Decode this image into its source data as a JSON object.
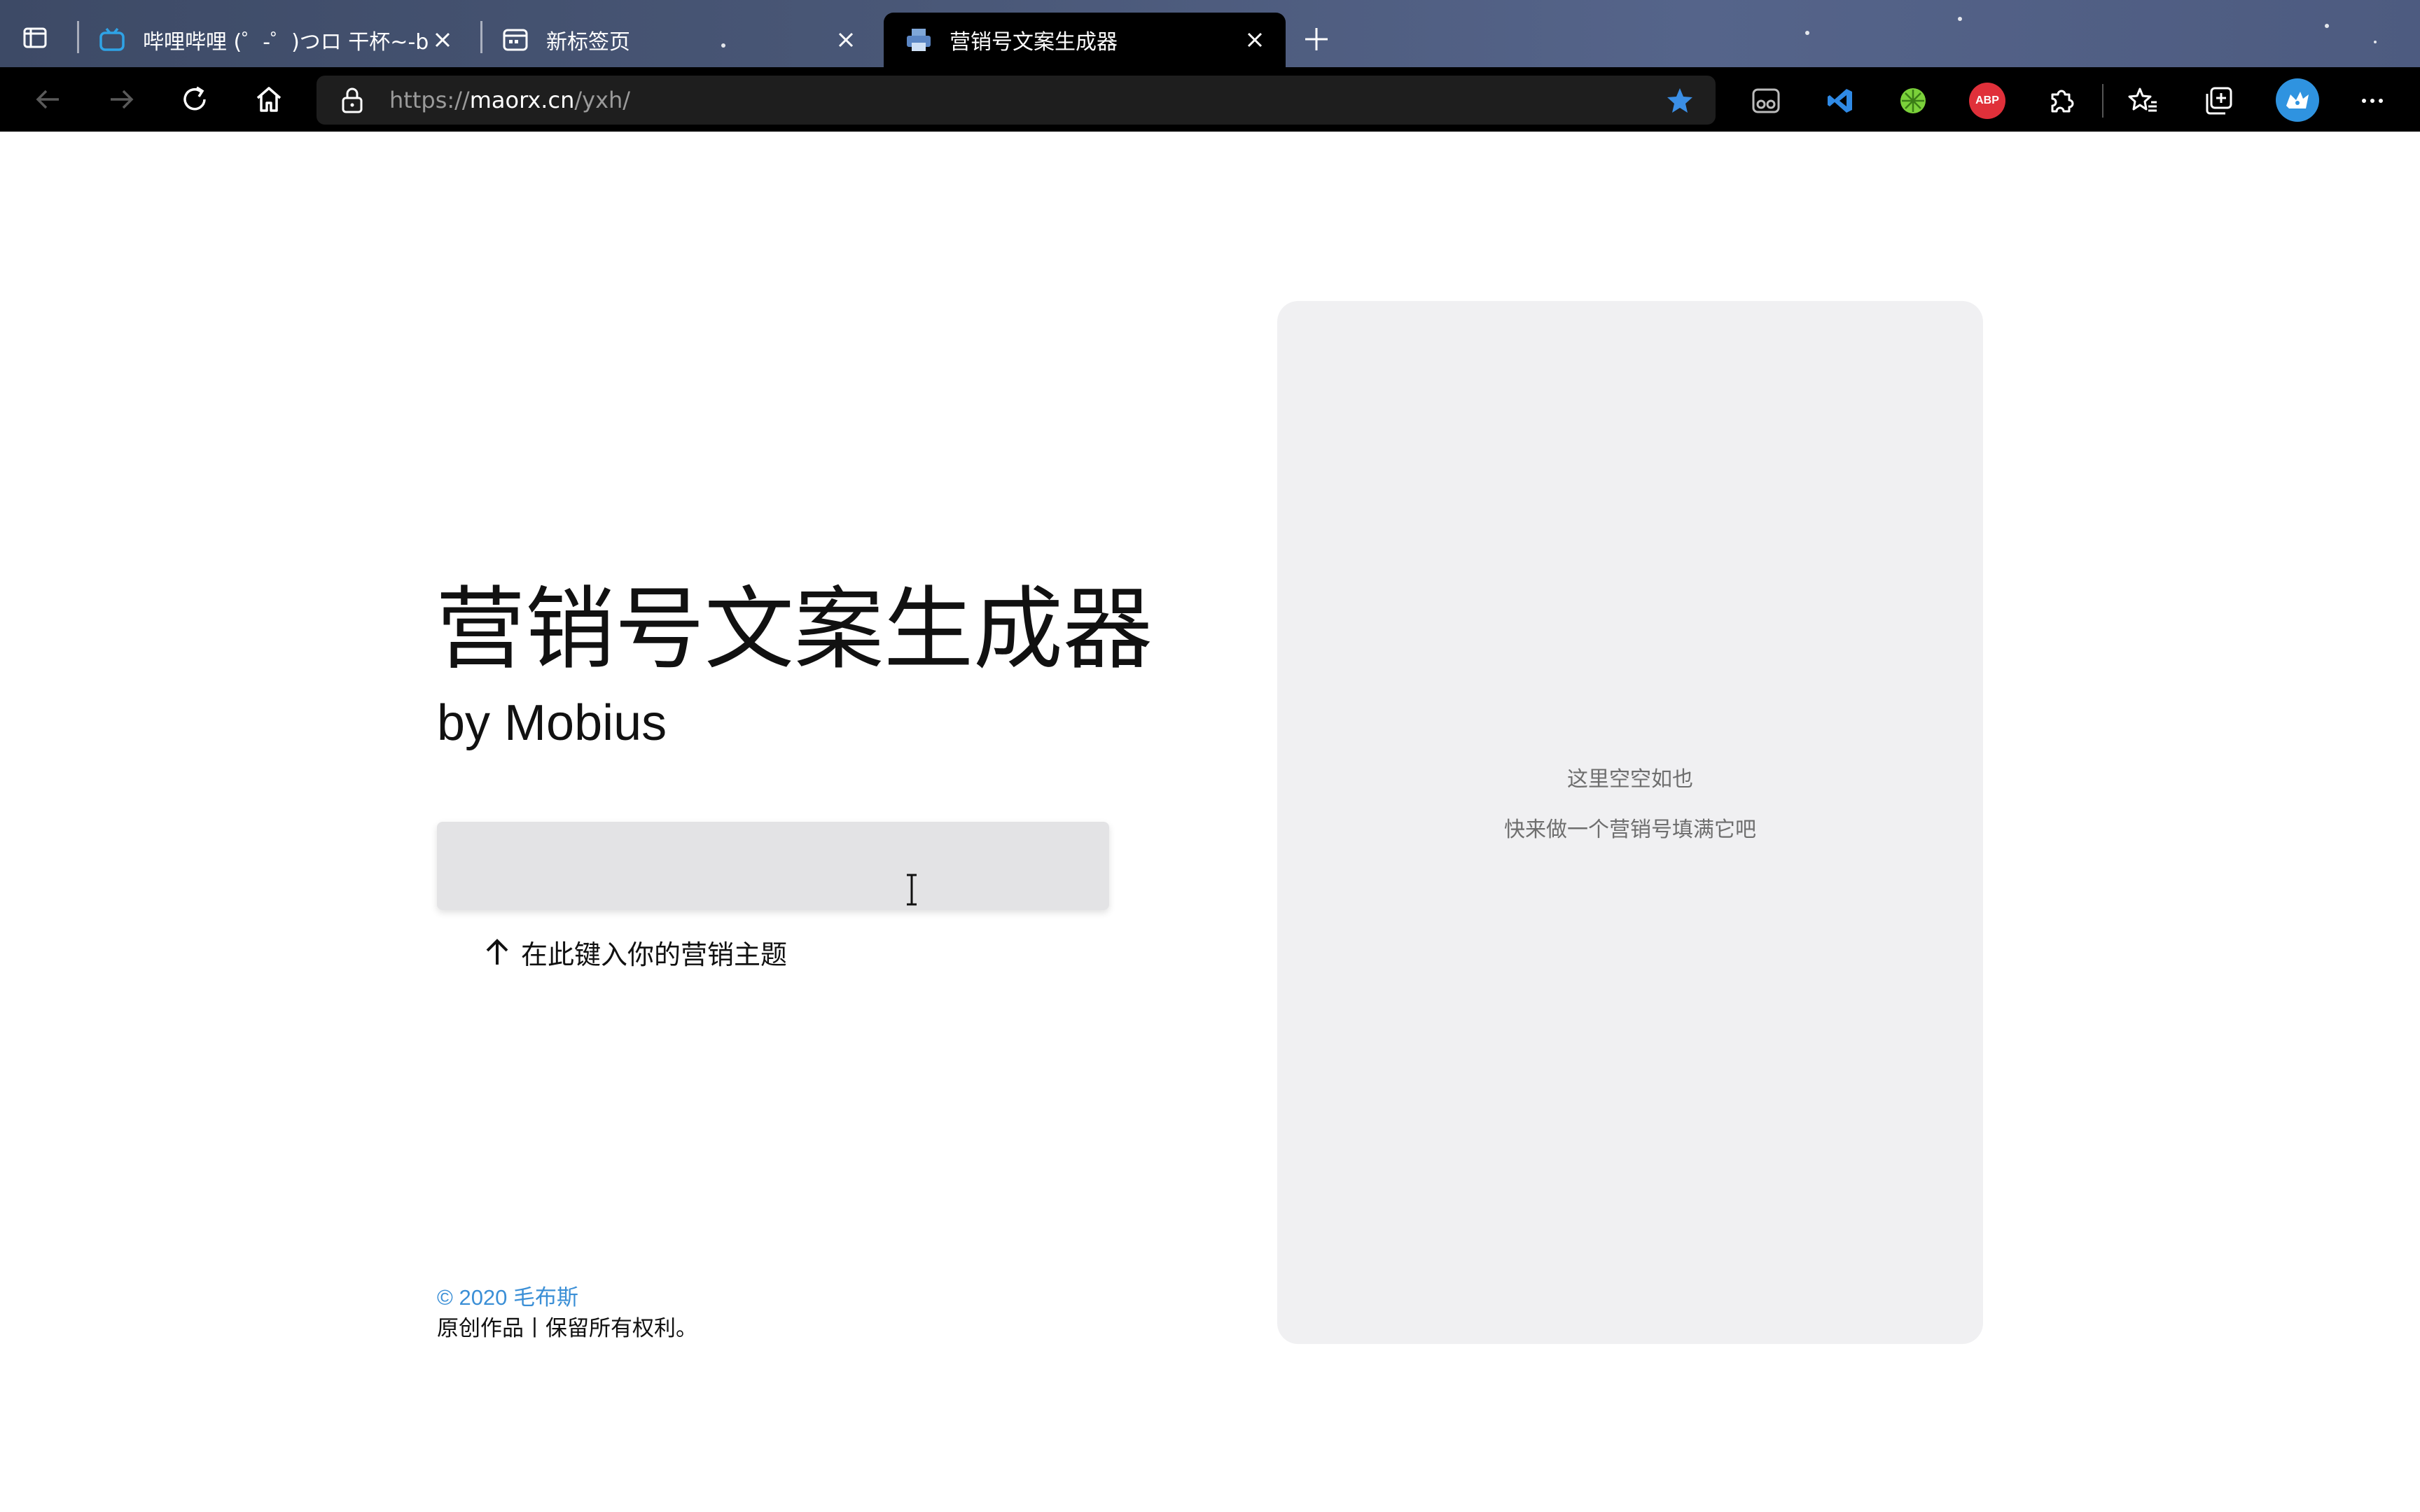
{
  "browser": {
    "tabs": [
      {
        "title": "哔哩哔哩 (゜-゜)つロ 干杯~-bilibili",
        "icon": "bilibili-tv-icon",
        "active": false
      },
      {
        "title": "新标签页",
        "icon": "new-tab-page-icon",
        "active": false
      },
      {
        "title": "营销号文案生成器",
        "icon": "printer-icon",
        "active": true
      }
    ],
    "address": {
      "scheme": "https://",
      "host": "maorx.cn",
      "path": "/yxh/"
    },
    "extensions": [
      "reading-glasses-icon",
      "vscode-icon",
      "green-wheel-icon",
      "adblock-plus-icon",
      "puzzle-extensions-icon",
      "favorites-icon",
      "collections-icon",
      "profile-avatar-icon",
      "more-menu-icon"
    ],
    "extension_labels": {
      "adblock": "ABP"
    }
  },
  "page": {
    "title": "营销号文案生成器",
    "subtitle": "by Mobius",
    "input": {
      "value": "",
      "placeholder": ""
    },
    "hint": "在此键入你的营销主题",
    "footer": {
      "copyright": "© 2020 毛布斯",
      "rights": "原创作品丨保留所有权利。"
    }
  },
  "result": {
    "empty_line1": "这里空空如也",
    "empty_line2": "快来做一个营销号填满它吧"
  },
  "colors": {
    "tabbar": "#4a5878",
    "toolbar": "#000000",
    "favorite_star": "#3b8fe6",
    "link_blue": "#3b8fd6",
    "panel_bg": "#f0f0f2",
    "input_bg": "#e3e3e5"
  }
}
